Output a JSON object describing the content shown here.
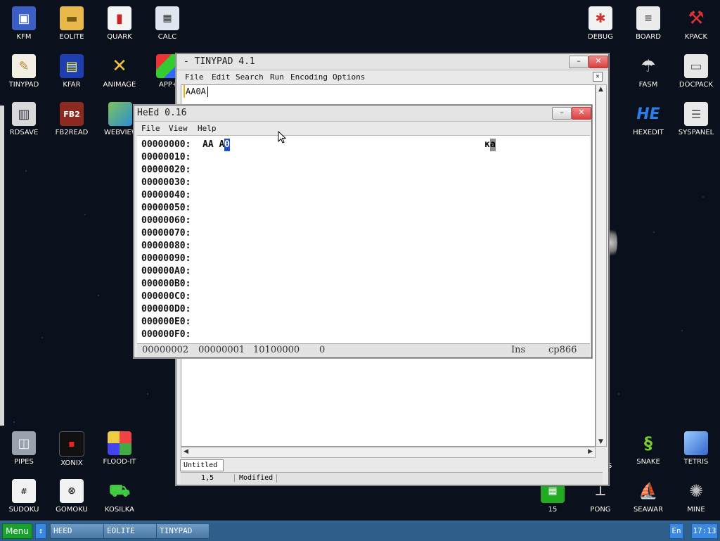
{
  "desktop": {
    "icons": [
      {
        "label": "KFM",
        "icon": "floppy-disk-icon"
      },
      {
        "label": "EOLITE",
        "icon": "folder-icon"
      },
      {
        "label": "QUARK",
        "icon": "notebook-icon"
      },
      {
        "label": "CALC",
        "icon": "calculator-icon"
      },
      {
        "label": "TINYPAD",
        "icon": "notepad-icon"
      },
      {
        "label": "KFAR",
        "icon": "kfar-icon"
      },
      {
        "label": "ANIMAGE",
        "icon": "pencil-cross-icon"
      },
      {
        "label": "APP+",
        "icon": "cube-icon"
      },
      {
        "label": "RDSAVE",
        "icon": "save-disk-icon"
      },
      {
        "label": "FB2READ",
        "icon": "book-icon"
      },
      {
        "label": "WEBVIEW",
        "icon": "globe-icon"
      },
      {
        "label": "DEBUG",
        "icon": "bug-icon"
      },
      {
        "label": "BOARD",
        "icon": "board-icon"
      },
      {
        "label": "KPACK",
        "icon": "hammer-icon"
      },
      {
        "label": "FASM",
        "icon": "fasm-icon"
      },
      {
        "label": "DOCPACK",
        "icon": "drawer-icon"
      },
      {
        "label": "HEXEDIT",
        "icon": "hexedit-icon"
      },
      {
        "label": "SYSPANEL",
        "icon": "sliders-icon"
      },
      {
        "label": "PIPES",
        "icon": "pipes-icon"
      },
      {
        "label": "XONIX",
        "icon": "xonix-icon"
      },
      {
        "label": "FLOOD-IT",
        "icon": "color-grid-icon"
      },
      {
        "label": "SUDOKU",
        "icon": "sudoku-icon"
      },
      {
        "label": "GOMOKU",
        "icon": "gomoku-icon"
      },
      {
        "label": "KOSILKA",
        "icon": "lawnmower-icon"
      },
      {
        "label": "S",
        "icon": "partial-icon"
      },
      {
        "label": "SNAKE",
        "icon": "snake-icon"
      },
      {
        "label": "TETRIS",
        "icon": "tetris-icon"
      },
      {
        "label": "15",
        "icon": "fifteen-grid-icon"
      },
      {
        "label": "PONG",
        "icon": "pong-icon"
      },
      {
        "label": "SEAWAR",
        "icon": "seawar-icon"
      },
      {
        "label": "MINE",
        "icon": "mine-icon"
      }
    ]
  },
  "tinypad": {
    "title": "- TINYPAD 4.1",
    "menu": [
      "File",
      "Edit",
      "Search",
      "Run",
      "Encoding",
      "Options"
    ],
    "text": "AA0A",
    "tab": "Untitled",
    "status": {
      "position": "1,5",
      "state": "Modified"
    }
  },
  "heed": {
    "title": "HeEd 0.16",
    "menu": [
      "File",
      "View",
      "Help"
    ],
    "rows": [
      {
        "addr": "00000000:",
        "hex": "AA A",
        "hex_sel": "0",
        "ascii": "к",
        "ascii_sel": "а"
      },
      {
        "addr": "00000010:"
      },
      {
        "addr": "00000020:"
      },
      {
        "addr": "00000030:"
      },
      {
        "addr": "00000040:"
      },
      {
        "addr": "00000050:"
      },
      {
        "addr": "00000060:"
      },
      {
        "addr": "00000070:"
      },
      {
        "addr": "00000080:"
      },
      {
        "addr": "00000090:"
      },
      {
        "addr": "000000A0:"
      },
      {
        "addr": "000000B0:"
      },
      {
        "addr": "000000C0:"
      },
      {
        "addr": "000000D0:"
      },
      {
        "addr": "000000E0:"
      },
      {
        "addr": "000000F0:"
      }
    ],
    "status": {
      "offset": "00000002",
      "value_hex": "00000001",
      "value_bin": "10100000",
      "value_dec": "0",
      "mode": "Ins",
      "encoding": "cp866"
    }
  },
  "taskbar": {
    "menu_label": "Menu",
    "tasks": [
      "HEED",
      "EOLITE",
      "TINYPAD"
    ],
    "lang": "En",
    "clock": "17:13"
  }
}
